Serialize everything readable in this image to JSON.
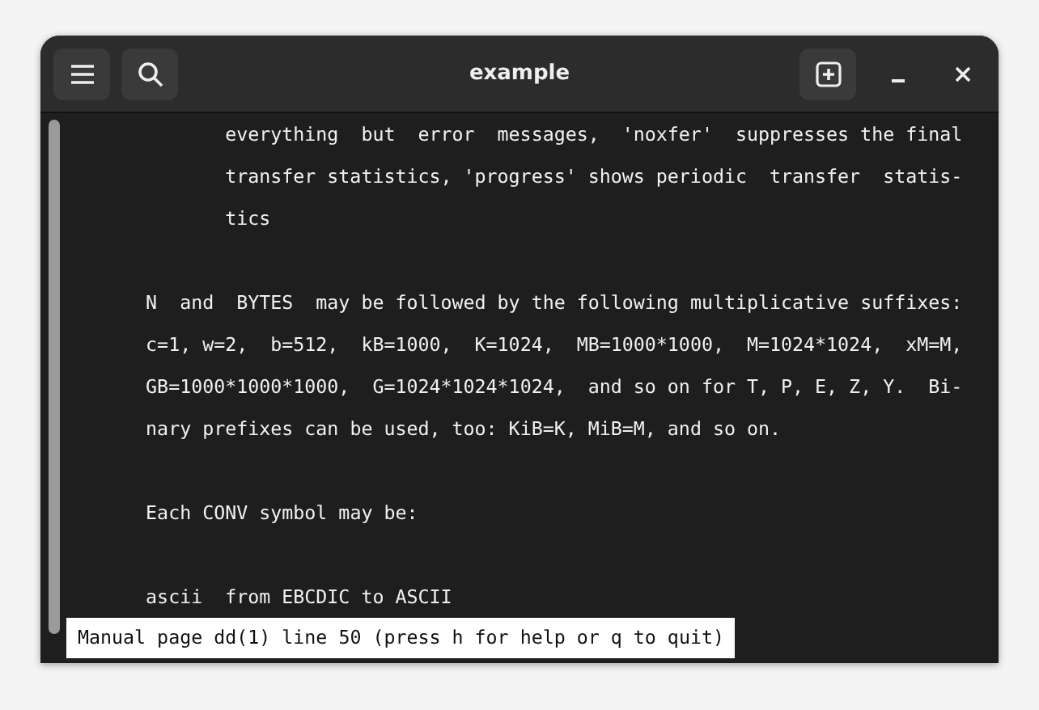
{
  "window": {
    "title": "example"
  },
  "lines": [
    {
      "kind": "nested",
      "text": "everything  but  error  messages,  'noxfer'  suppresses the final"
    },
    {
      "kind": "nested",
      "text": "transfer statistics, 'progress' shows periodic  transfer  statis-"
    },
    {
      "kind": "nested",
      "text": "tics"
    },
    {
      "kind": "blank"
    },
    {
      "kind": "body",
      "text": "N  and  BYTES  may be followed by the following multiplicative suffixes:"
    },
    {
      "kind": "body",
      "text": "c=1, w=2,  b=512,  kB=1000,  K=1024,  MB=1000*1000,  M=1024*1024,  xM=M,"
    },
    {
      "kind": "body",
      "text": "GB=1000*1000*1000,  G=1024*1024*1024,  and so on for T, P, E, Z, Y.  Bi-"
    },
    {
      "kind": "body",
      "text": "nary prefixes can be used, too: KiB=K, MiB=M, and so on."
    },
    {
      "kind": "blank"
    },
    {
      "kind": "body",
      "text": "Each CONV symbol may be:"
    },
    {
      "kind": "blank"
    },
    {
      "kind": "body",
      "text": "ascii  from EBCDIC to ASCII"
    }
  ],
  "status_line": "Manual page dd(1) line 50 (press h for help or q to quit)"
}
